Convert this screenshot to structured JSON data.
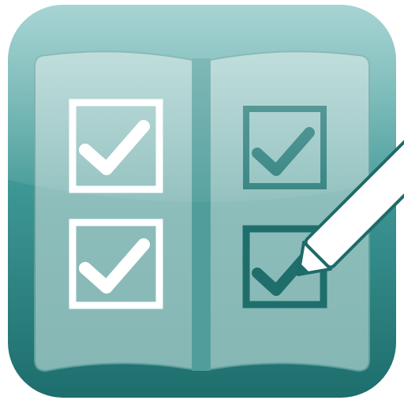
{
  "icon": {
    "name": "checklist-app-icon",
    "colors": {
      "tile_top": "#6fb5b3",
      "tile_mid": "#2f8c8a",
      "tile_bottom": "#1d6f6d",
      "page": "#8fbfbd",
      "checkbox_white": "#ffffff",
      "checkbox_teal": "#2a7e7c",
      "pencil": "#ffffff",
      "pencil_outline": "#1e6b69"
    },
    "checkboxes": [
      {
        "id": "top-left",
        "checked": true,
        "style": "white"
      },
      {
        "id": "top-right",
        "checked": true,
        "style": "teal"
      },
      {
        "id": "bottom-left",
        "checked": true,
        "style": "white"
      },
      {
        "id": "bottom-right",
        "checked": true,
        "style": "teal"
      }
    ]
  }
}
